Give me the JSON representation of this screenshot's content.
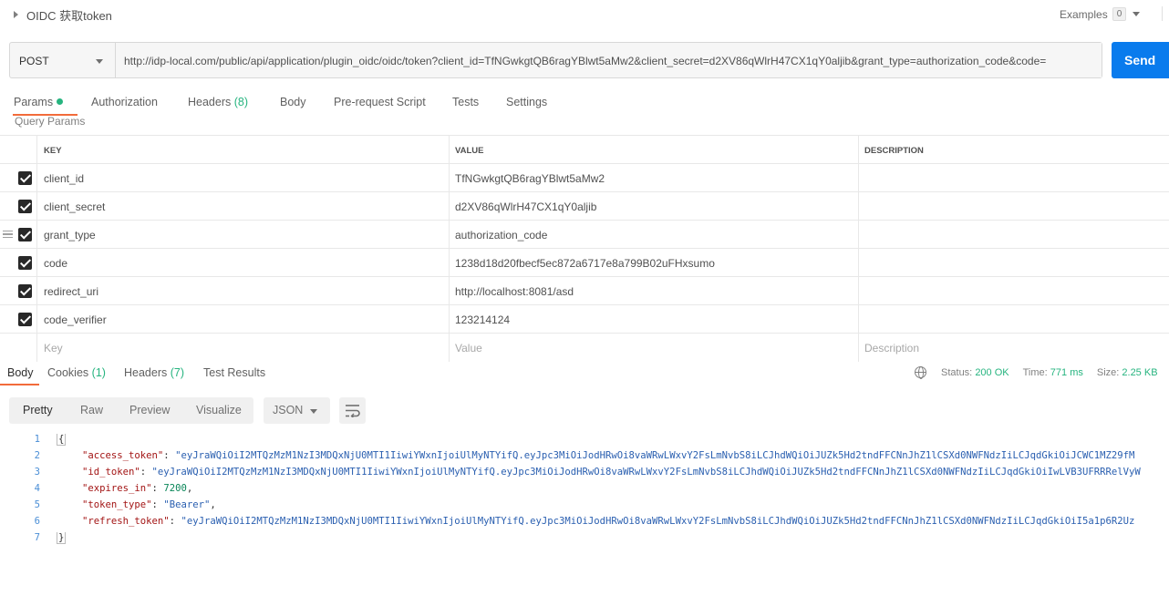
{
  "request": {
    "title": "OIDC 获取token",
    "examples_label": "Examples",
    "examples_count": "0",
    "method": "POST",
    "url": "http://idp-local.com/public/api/application/plugin_oidc/oidc/token?client_id=TfNGwkgtQB6ragYBlwt5aMw2&client_secret=d2XV86qWlrH47CX1qY0aljib&grant_type=authorization_code&code=",
    "send_label": "Send"
  },
  "req_tabs": {
    "params": "Params",
    "authorization": "Authorization",
    "headers": "Headers",
    "headers_count": "(8)",
    "body": "Body",
    "prerequest": "Pre-request Script",
    "tests": "Tests",
    "settings": "Settings"
  },
  "query_params_label": "Query Params",
  "params_table": {
    "headers": {
      "key": "KEY",
      "value": "VALUE",
      "description": "DESCRIPTION"
    },
    "rows": [
      {
        "key": "client_id",
        "value": "TfNGwkgtQB6ragYBlwt5aMw2",
        "description": ""
      },
      {
        "key": "client_secret",
        "value": "d2XV86qWlrH47CX1qY0aljib",
        "description": ""
      },
      {
        "key": "grant_type",
        "value": "authorization_code",
        "description": ""
      },
      {
        "key": "code",
        "value": "1238d18d20fbecf5ec872a6717e8a799B02uFHxsumo",
        "description": ""
      },
      {
        "key": "redirect_uri",
        "value": "http://localhost:8081/asd",
        "description": ""
      },
      {
        "key": "code_verifier",
        "value": "123214124",
        "description": ""
      }
    ],
    "placeholder": {
      "key": "Key",
      "value": "Value",
      "description": "Description"
    }
  },
  "res_tabs": {
    "body": "Body",
    "cookies": "Cookies",
    "cookies_count": "(1)",
    "headers": "Headers",
    "headers_count": "(7)",
    "test_results": "Test Results"
  },
  "status": {
    "status_label": "Status:",
    "status_value": "200 OK",
    "time_label": "Time:",
    "time_value": "771 ms",
    "size_label": "Size:",
    "size_value": "2.25 KB"
  },
  "response_toolbar": {
    "pretty": "Pretty",
    "raw": "Raw",
    "preview": "Preview",
    "visualize": "Visualize",
    "format": "JSON"
  },
  "response_body": {
    "line_numbers": [
      "1",
      "2",
      "3",
      "4",
      "5",
      "6",
      "7"
    ],
    "open_brace": "{",
    "close_brace": "}",
    "access_token_key": "\"access_token\"",
    "access_token_value": "\"eyJraWQiOiI2MTQzMzM1NzI3MDQxNjU0MTI1IiwiYWxnIjoiUlMyNTYifQ.eyJpc3MiOiJodHRwOi8vaWRwLWxvY2FsLmNvbS8iLCJhdWQiOiJUZk5Hd2tndFFCNnJhZ1lCSXd0NWFNdzIiLCJqdGkiOiJCWC1MZ29fM",
    "id_token_key": "\"id_token\"",
    "id_token_value": "\"eyJraWQiOiI2MTQzMzM1NzI3MDQxNjU0MTI1IiwiYWxnIjoiUlMyNTYifQ.eyJpc3MiOiJodHRwOi8vaWRwLWxvY2FsLmNvbS8iLCJhdWQiOiJUZk5Hd2tndFFCNnJhZ1lCSXd0NWFNdzIiLCJqdGkiOiIwLVB3UFRRRelVyW",
    "expires_in_key": "\"expires_in\"",
    "expires_in_value": "7200",
    "token_type_key": "\"token_type\"",
    "token_type_value": "\"Bearer\"",
    "refresh_token_key": "\"refresh_token\"",
    "refresh_token_value": "\"eyJraWQiOiI2MTQzMzM1NzI3MDQxNjU0MTI1IiwiYWxnIjoiUlMyNTYifQ.eyJpc3MiOiJodHRwOi8vaWRwLWxvY2FsLmNvbS8iLCJhdWQiOiJUZk5Hd2tndFFCNnJhZ1lCSXd0NWFNdzIiLCJqdGkiOiI5a1p6R2Uz"
  },
  "colors": {
    "accent": "#097bed",
    "tab_underline": "#f26b3a",
    "success": "#26b47f"
  }
}
